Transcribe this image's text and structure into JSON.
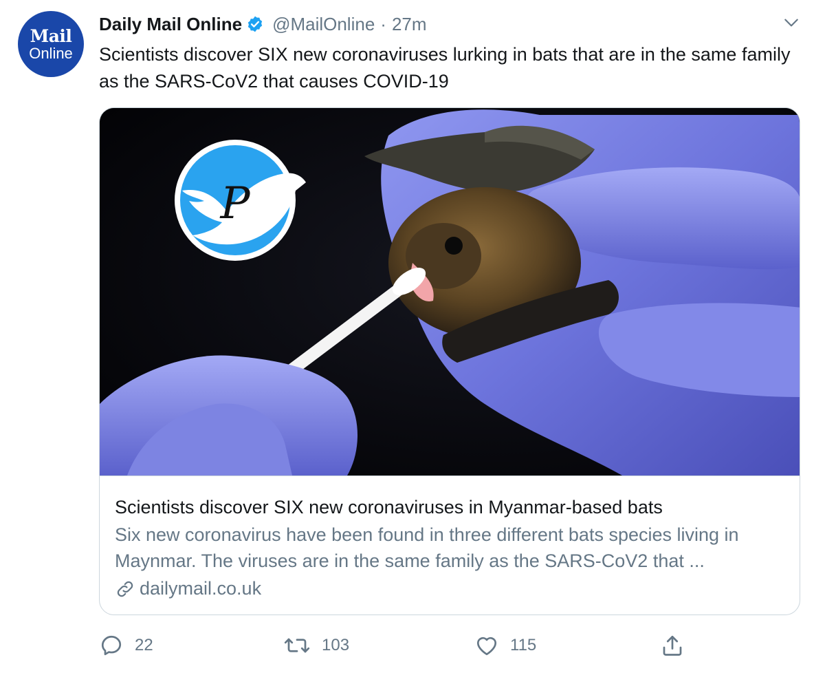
{
  "author": {
    "logo_top": "Mail",
    "logo_bottom": "Online",
    "name": "Daily Mail Online",
    "handle": "@MailOnline",
    "separator": "·",
    "time": "27m"
  },
  "tweet": {
    "text": "Scientists discover SIX new coronaviruses lurking in bats that are in the same family as the SARS-CoV2 that causes COVID-19"
  },
  "card": {
    "title": "Scientists discover SIX new coronaviruses in Myanmar-based bats",
    "description": "Six new coronavirus have been found in three different bats species living in Maynmar. The viruses are in the same family as the SARS-CoV2 that ...",
    "domain": "dailymail.co.uk",
    "watermark_letter": "P"
  },
  "actions": {
    "replies": "22",
    "retweets": "103",
    "likes": "115"
  },
  "icons": {
    "verified": "verified-badge-icon",
    "caret": "chevron-down-icon",
    "link": "link-icon",
    "reply": "reply-icon",
    "retweet": "retweet-icon",
    "like": "heart-icon",
    "share": "share-icon"
  },
  "colors": {
    "accent": "#1da1f2",
    "mail_blue": "#1a47a9",
    "text": "#14171a",
    "secondary": "#657786",
    "border": "#ccd6dd"
  }
}
